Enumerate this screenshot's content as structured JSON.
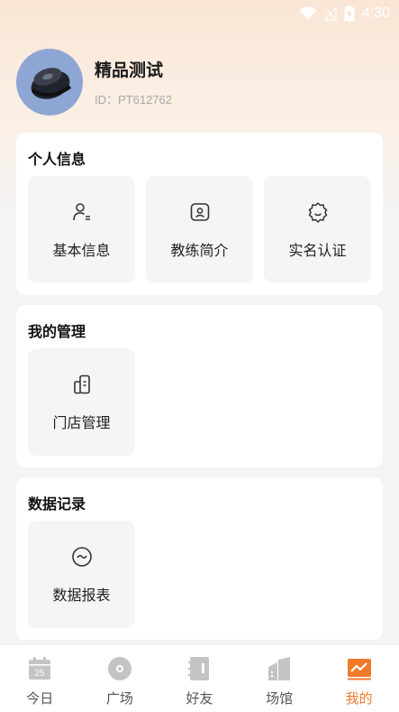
{
  "status": {
    "time": "4:30"
  },
  "profile": {
    "name": "精品测试",
    "id_text": "ID：PT612762"
  },
  "sections": [
    {
      "title": "个人信息",
      "tiles": [
        {
          "label": "基本信息",
          "icon": "person-info-icon"
        },
        {
          "label": "教练简介",
          "icon": "coach-profile-icon"
        },
        {
          "label": "实名认证",
          "icon": "verify-badge-icon"
        }
      ]
    },
    {
      "title": "我的管理",
      "tiles": [
        {
          "label": "门店管理",
          "icon": "store-icon"
        }
      ]
    },
    {
      "title": "数据记录",
      "tiles": [
        {
          "label": "数据报表",
          "icon": "data-report-icon"
        }
      ]
    }
  ],
  "tabs": [
    {
      "label": "今日",
      "icon": "calendar-icon",
      "badge": "25",
      "active": false
    },
    {
      "label": "广场",
      "icon": "plaza-icon",
      "active": false
    },
    {
      "label": "好友",
      "icon": "contacts-icon",
      "active": false
    },
    {
      "label": "场馆",
      "icon": "venue-icon",
      "active": false
    },
    {
      "label": "我的",
      "icon": "mine-chart-icon",
      "active": true
    }
  ],
  "colors": {
    "accent": "#f07a2c",
    "tile_bg": "#f5f5f5",
    "avatar_bg": "#8ea6d4"
  }
}
